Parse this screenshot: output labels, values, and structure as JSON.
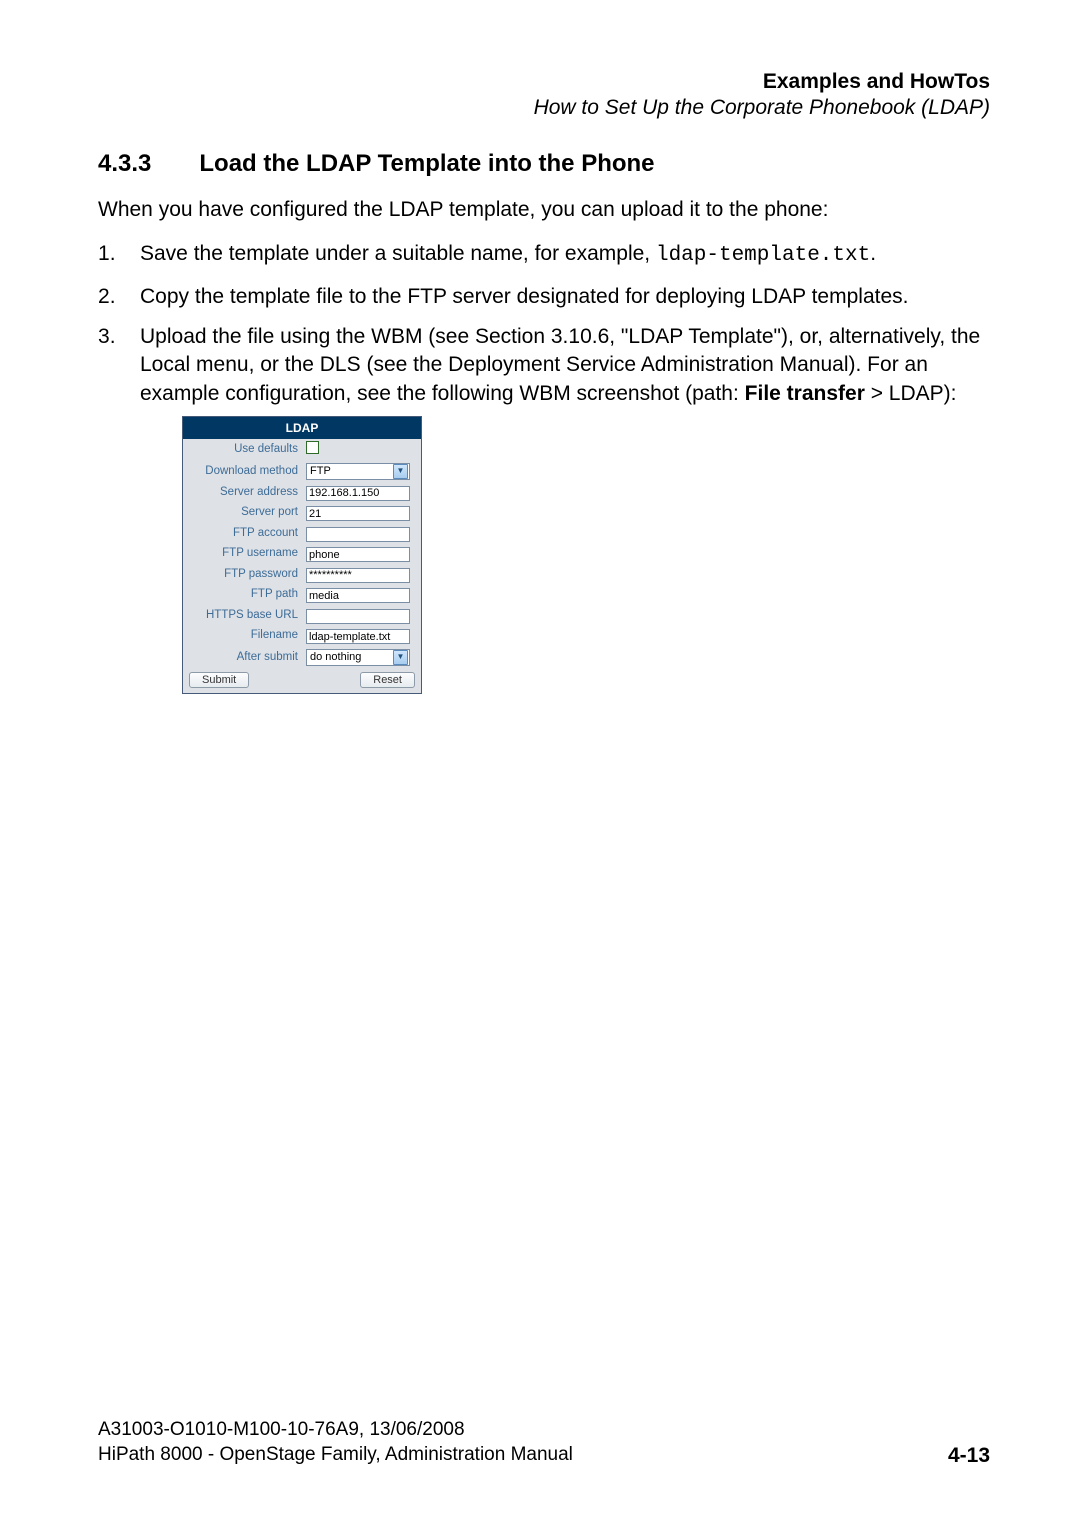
{
  "header": {
    "line1": "Examples and HowTos",
    "line2": "How to Set Up the Corporate Phonebook (LDAP)"
  },
  "section": {
    "number": "4.3.3",
    "title": "Load the LDAP Template into the Phone"
  },
  "intro": "When you have configured the LDAP template, you can upload it to the phone:",
  "steps": {
    "s1_a": "Save the template under a suitable name, for example, ",
    "s1_code": "ldap-template.txt",
    "s1_b": ".",
    "s2": "Copy the template file to the FTP server designated for deploying LDAP templates.",
    "s3_a": "Upload the file using the WBM (see Section 3.10.6, \"LDAP Template\"), or, alternatively, the Local menu, or the DLS (see the Deployment Service Administration Manual). For an example configuration, see the following WBM screenshot (path: ",
    "s3_bold": "File transfer",
    "s3_b": " > LDAP):"
  },
  "ldap": {
    "title": "LDAP",
    "labels": {
      "use_defaults": "Use defaults",
      "download_method": "Download method",
      "server_address": "Server address",
      "server_port": "Server port",
      "ftp_account": "FTP account",
      "ftp_username": "FTP username",
      "ftp_password": "FTP password",
      "ftp_path": "FTP path",
      "https_base_url": "HTTPS base URL",
      "filename": "Filename",
      "after_submit": "After submit"
    },
    "values": {
      "download_method": "FTP",
      "server_address": "192.168.1.150",
      "server_port": "21",
      "ftp_account": "",
      "ftp_username": "phone",
      "ftp_password": "**********",
      "ftp_path": "media",
      "https_base_url": "",
      "filename": "ldap-template.txt",
      "after_submit": "do nothing"
    },
    "buttons": {
      "submit": "Submit",
      "reset": "Reset"
    }
  },
  "footer": {
    "line1": "A31003-O1010-M100-10-76A9, 13/06/2008",
    "line2": "HiPath 8000 - OpenStage Family, Administration Manual",
    "page": "4-13"
  }
}
